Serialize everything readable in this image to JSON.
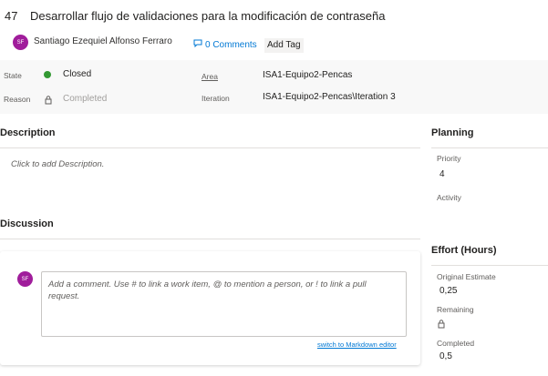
{
  "work_item": {
    "id": "47",
    "title": "Desarrollar flujo de validaciones para la modificación de contraseña",
    "assignee_initials": "SF",
    "assignee": "Santiago Ezequiel Alfonso Ferraro",
    "comments_label": "0 Comments",
    "add_tag_label": "Add Tag"
  },
  "fields": {
    "state_label": "State",
    "state_value": "Closed",
    "state_color": "#339933",
    "reason_label": "Reason",
    "reason_value": "Completed",
    "area_label": "Area",
    "area_value": "ISA1-Equipo2-Pencas",
    "iteration_label": "Iteration",
    "iteration_value": "ISA1-Equipo2-Pencas\\Iteration 3"
  },
  "description": {
    "heading": "Description",
    "placeholder": "Click to add Description."
  },
  "discussion": {
    "heading": "Discussion",
    "avatar_initials": "SF",
    "comment_placeholder": "Add a comment. Use # to link a work item, @ to mention a person, or ! to link a pull request.",
    "markdown_link": "switch to Markdown editor"
  },
  "planning": {
    "heading": "Planning",
    "priority_label": "Priority",
    "priority_value": "4",
    "activity_label": "Activity"
  },
  "effort": {
    "heading": "Effort (Hours)",
    "original_estimate_label": "Original Estimate",
    "original_estimate_value": "0,25",
    "remaining_label": "Remaining",
    "completed_label": "Completed",
    "completed_value": "0,5"
  },
  "colors": {
    "avatar": "#a01d9b",
    "link": "#0078d4"
  }
}
